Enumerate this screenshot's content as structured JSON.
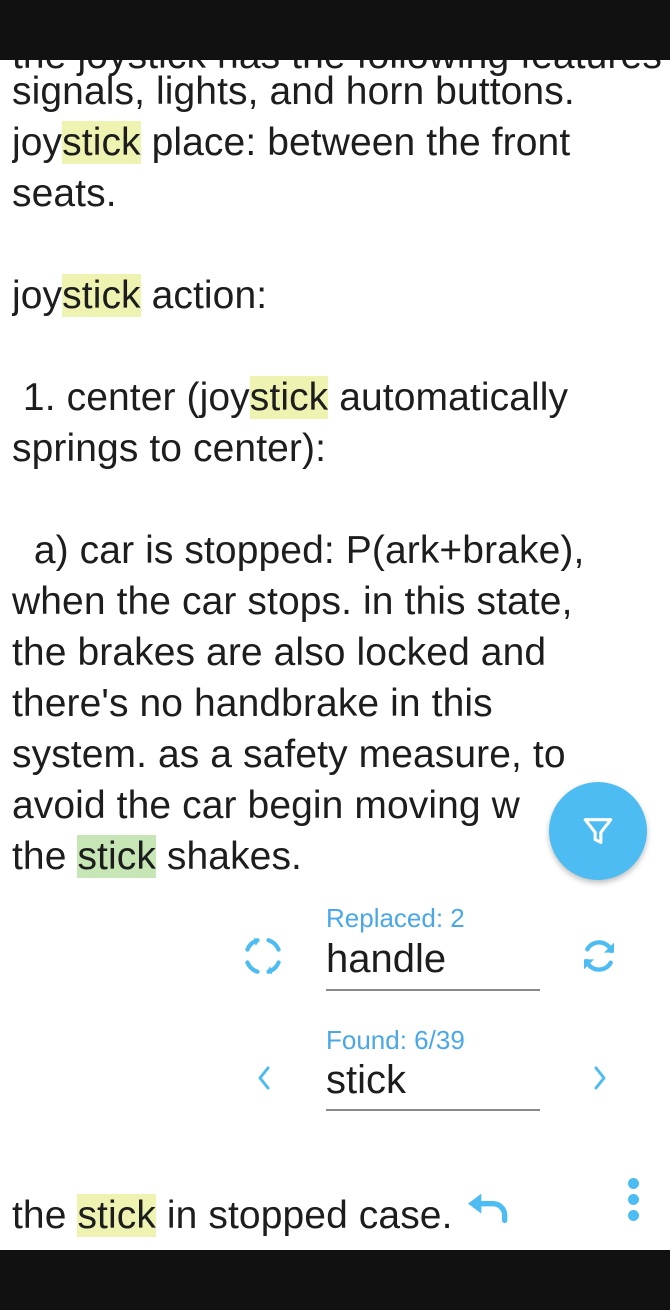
{
  "text": {
    "cut_top": "the joystick has the following features: turn",
    "line1": "signals, lights, and horn buttons.",
    "line2_pre": "joy",
    "line2_hl": "stick",
    "line2_post": " place: between the front",
    "line3": "seats.",
    "line5_pre": "joy",
    "line5_hl": "stick",
    "line5_post": " action:",
    "line7_pre": " 1. center (joy",
    "line7_hl": "stick",
    "line7_post": " automatically",
    "line8": "springs to center):",
    "line10": "  a) car is stopped: P(ark+brake),",
    "line11": "when the car stops. in this state,",
    "line12": "the brakes are also locked and",
    "line13": "there's no handbrake in this",
    "line14": "system. as a safety measure, to",
    "line15": "avoid the car begin moving w",
    "line16_pre": "the ",
    "line16_hl": "stick",
    "line16_post": " shakes.",
    "line18_pre": "the ",
    "line18_hl": "stick",
    "line18_post": " in stopped case."
  },
  "replace": {
    "label": "Replaced: 2",
    "value": "handle"
  },
  "find": {
    "label": "Found: 6/39",
    "value": "stick"
  },
  "icons": {
    "filter": "filter-icon",
    "replace_one": "replace-single-icon",
    "replace_all": "replace-all-icon",
    "prev": "chevron-left-icon",
    "next": "chevron-right-icon",
    "undo": "undo-icon",
    "menu": "more-vert-icon"
  },
  "colors": {
    "accent": "#4dbcf2",
    "label": "#4aa8e8",
    "highlight": "#eef3b1",
    "current_highlight": "#c7e6b6"
  }
}
